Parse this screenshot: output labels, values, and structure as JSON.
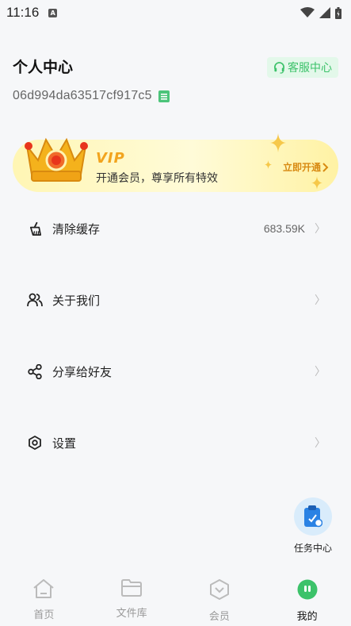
{
  "status": {
    "time": "11:16",
    "notif": "A"
  },
  "header": {
    "title": "个人中心",
    "service_label": "客服中心",
    "user_id": "06d994da63517cf917c5"
  },
  "vip": {
    "title": "VIP",
    "desc": "开通会员，尊享所有特效",
    "action": "立即开通"
  },
  "menu": [
    {
      "label": "清除缓存",
      "value": "683.59K",
      "icon": "broom-icon"
    },
    {
      "label": "关于我们",
      "icon": "users-icon"
    },
    {
      "label": "分享给好友",
      "icon": "share-icon"
    },
    {
      "label": "设置",
      "icon": "gear-icon"
    }
  ],
  "task": {
    "label": "任务中心"
  },
  "tabs": [
    {
      "label": "首页",
      "icon": "home-icon"
    },
    {
      "label": "文件库",
      "icon": "folder-icon"
    },
    {
      "label": "会员",
      "icon": "member-icon"
    },
    {
      "label": "我的",
      "icon": "profile-face-icon",
      "active": true
    }
  ],
  "colors": {
    "accent": "#3cc26a",
    "vip_gold": "#f2a41e",
    "task_blue": "#2a82e4"
  }
}
